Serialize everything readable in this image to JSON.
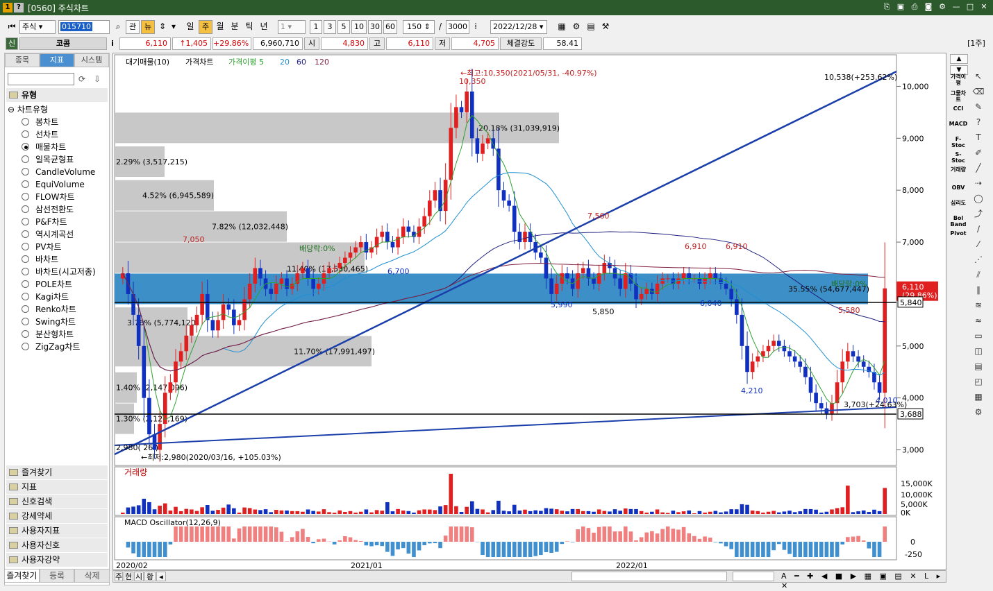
{
  "window": {
    "title": "[0560] 주식차트",
    "badge1": "1",
    "badge2": "?"
  },
  "toolbar": {
    "market": "주식",
    "code": "015710",
    "btn_gwan": "관",
    "btn_nyu": "뉴",
    "periods": [
      "일",
      "주",
      "월",
      "분",
      "틱",
      "년"
    ],
    "minute_value": "1",
    "minute_presets": [
      "1",
      "3",
      "5",
      "10",
      "30",
      "60"
    ],
    "count": "150",
    "sep": "/",
    "total": "3000",
    "date": "2022/12/28"
  },
  "quote": {
    "sin": "신",
    "name": "코콤",
    "info": "i",
    "price": "6,110",
    "change": "↑1,405",
    "rate": "+29.86%",
    "volume": "6,960,710",
    "open_label": "시",
    "open": "4,830",
    "high_label": "고",
    "high": "6,110",
    "low_label": "저",
    "low": "4,705",
    "strength_label": "체결강도",
    "strength": "58.41",
    "period_tag": "[1주]"
  },
  "left": {
    "tabs": [
      "종목",
      "지표",
      "시스템"
    ],
    "type_header": "유형",
    "group_label": "차트유형",
    "types": [
      "봉차트",
      "선차트",
      "매물차트",
      "일목균형표",
      "CandleVolume",
      "EquiVolume",
      "FLOW차트",
      "삼선전환도",
      "P&F차트",
      "역시계곡선",
      "PV차트",
      "바차트",
      "바차트(시고저종)",
      "POLE차트",
      "Kagi차트",
      "Renko차트",
      "Swing차트",
      "분산형차트",
      "ZigZag차트"
    ],
    "selected_type": "매물차트",
    "sections": [
      "즐겨찾기",
      "지표",
      "신호검색",
      "강세약세",
      "사용자지표",
      "사용자신호",
      "사용자강약"
    ],
    "bottom_tabs": [
      "즐겨찾기",
      "등록",
      "삭제"
    ]
  },
  "chart": {
    "legend": {
      "a": "대기매물(10)",
      "b": "가격차트",
      "c": "가격이평 5",
      "d": "20",
      "e": "60",
      "f": "120"
    },
    "volume_title": "거래량",
    "macd_title": "MACD Oscillator(12,26,9)",
    "x_labels": [
      "2020/02",
      "2021/01",
      "2022/01"
    ],
    "price_axis": [
      "10,000",
      "9,000",
      "8,000",
      "7,000",
      "5,000",
      "4,000",
      "3,000"
    ],
    "vol_axis": [
      "15,000K",
      "10,000K",
      "5,000K",
      "0K"
    ],
    "macd_axis": [
      "0",
      "-250"
    ],
    "price_tag": "6,110",
    "price_tag2": "(29.86%)",
    "line1_tag": "5,840",
    "line2_tag": "3,688",
    "annotations": {
      "high": "←최고:10,350(2021/05/31, -40.97%)",
      "low": "←최저:2,980(2020/03/16, +105.03%)",
      "trend_end": "10,538(+253.62%)",
      "trend_low": "3,703(+24.63%)",
      "dividend1": "배당락:0%",
      "dividend2": "배당락:0%",
      "p10350": "10,350",
      "p7050": "7,050",
      "p6700": "6,700",
      "p7560": "7,560",
      "p6910a": "6,910",
      "p6910b": "6,910",
      "p5990": "5,990",
      "p5850": "5,850",
      "p6040": "6,040",
      "p5580": "5,580",
      "p4210": "4,210",
      "p4010": "4,010",
      "p2980": "2,980( 26 )"
    },
    "profile": [
      {
        "label": "20.18% (31,039,919)"
      },
      {
        "label": "2.29% (3,517,215)"
      },
      {
        "label": "4.52% (6,945,589)"
      },
      {
        "label": "7.82% (12,032,448)"
      },
      {
        "label": "11.40% (17,530,465)"
      },
      {
        "label": "35.55% (54,677,447)"
      },
      {
        "label": "3.76% (5,774,120)"
      },
      {
        "label": "11.70% (17,991,497)"
      },
      {
        "label": "1.40% (2,147,096)"
      },
      {
        "label": "1.30% (2,122,169)"
      }
    ]
  },
  "statusbar": {
    "b1": "주",
    "b2": "현",
    "b3": "시",
    "b4": "황",
    "b5": "◂"
  },
  "indicators": [
    "가격이평",
    "그물차트",
    "CCI",
    "MACD",
    "F-Stoc",
    "S-Stoc",
    "거래량",
    "OBV",
    "심리도",
    "Bol Band",
    "Pivot"
  ]
}
